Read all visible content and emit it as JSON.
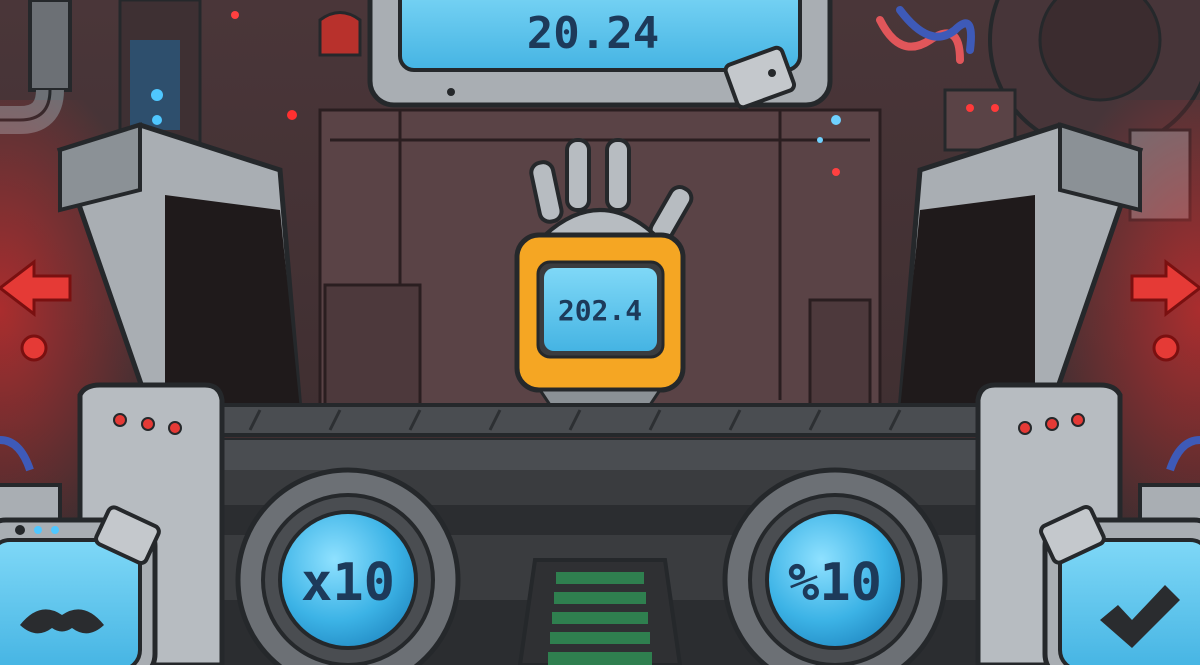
{
  "game": {
    "target_display": "20.24",
    "robot_display": "202.4",
    "multiply_button_label": "x10",
    "divide_button_label": "%10"
  },
  "icons": {
    "left_arrow": "arrow-left-icon",
    "right_arrow": "arrow-right-icon",
    "mustache": "mustache-icon",
    "checkmark": "checkmark-icon",
    "robot_hand": "robot-hand-icon"
  },
  "colors": {
    "screen_blue": "#5cc3ea",
    "screen_text": "#1d3a5a",
    "robot_orange": "#f5a623",
    "warning_red": "#e53a36",
    "metal_grey": "#a9aeb3",
    "panel_dark": "#3a3c3f",
    "indicator_green": "#2f7f4f"
  }
}
